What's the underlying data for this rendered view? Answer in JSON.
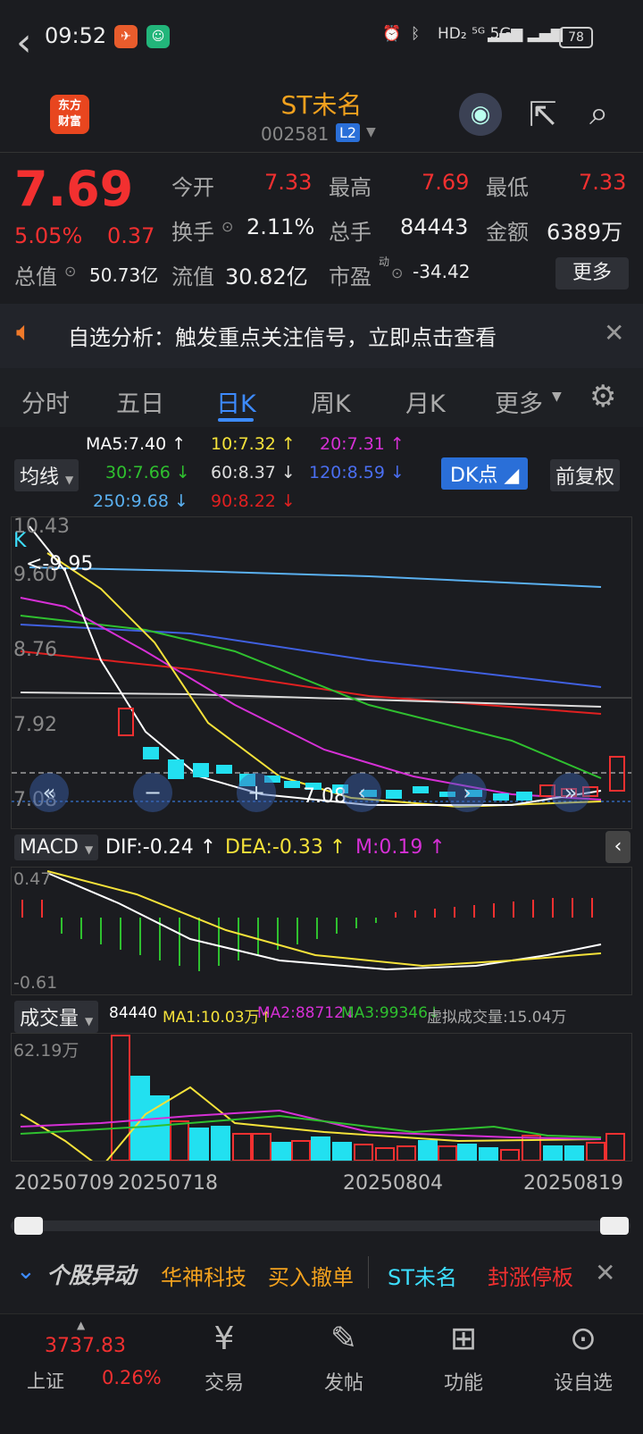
{
  "status_bar": {
    "time": "09:52",
    "battery": "78",
    "network": "HD₂ ⁵ᴳ 5G"
  },
  "header": {
    "back": "‹",
    "logo": "东方\n财富",
    "title": "ST未名",
    "code": "002581",
    "level": "L2"
  },
  "quote": {
    "price": "7.69",
    "change_pct": "5.05%",
    "change": "0.37",
    "open_label": "今开",
    "open": "7.33",
    "high_label": "最高",
    "high": "7.69",
    "low_label": "最低",
    "low": "7.33",
    "turnover_label": "换手",
    "turnover": "2.11%",
    "volume_label": "总手",
    "volume": "84443",
    "amount_label": "金额",
    "amount": "6389万",
    "mktcap_label": "总值",
    "mktcap": "50.73亿",
    "float_label": "流值",
    "float": "30.82亿",
    "pe_label": "市盈",
    "pe_sup": "动",
    "pe": "-34.42",
    "more": "更多"
  },
  "banner": {
    "text": "自选分析：触发重点关注信号，立即点击查看"
  },
  "tabs": [
    "分时",
    "五日",
    "日K",
    "周K",
    "月K",
    "更多"
  ],
  "ma": {
    "selector": "均线",
    "ma5": "MA5:7.40",
    "ma10": "10:7.32",
    "ma20": "20:7.31",
    "ma30": "30:7.66",
    "ma60": "60:8.37",
    "ma120": "120:8.59",
    "ma250": "250:9.68",
    "ma90": "90:8.22",
    "dk": "DK点",
    "adjust": "前复权"
  },
  "kline": {
    "y_labels": [
      "10.43",
      "9.60",
      "8.76",
      "7.92",
      "7.08"
    ],
    "marker_high": "9.95",
    "marker_low": "7.08",
    "k_label": "K",
    "colors": {
      "up": "#f23030",
      "down": "#22e0f0",
      "ma5": "#ffffff",
      "ma10": "#f5e23a",
      "ma20": "#d630d6",
      "ma30": "#2fc02f",
      "ma60": "#dddddd",
      "ma120": "#4060e0",
      "ma250": "#5ab0f0",
      "ma90": "#e02020"
    }
  },
  "macd": {
    "selector": "MACD",
    "dif": "DIF:-0.24",
    "dea": "DEA:-0.33",
    "m": "M:0.19",
    "top": "0.47",
    "bottom": "-0.61"
  },
  "volume": {
    "selector": "成交量",
    "value": "84440",
    "ma1": "MA1:10.03万",
    "ma2": "MA2:88712",
    "ma3": "MA3:99346",
    "virtual": "虚拟成交量:15.04万",
    "top": "62.19万"
  },
  "dates": [
    "20250709",
    "20250718",
    "20250804",
    "20250819"
  ],
  "ticker": {
    "title": "个股异动",
    "item1": "华神科技",
    "item1b": "买入撤单",
    "item2": "ST未名",
    "item2b": "封涨停板"
  },
  "bottom_nav": {
    "index_value": "3737.83",
    "index_name": "上证",
    "index_pct": "0.26%",
    "trade": "交易",
    "post": "发帖",
    "func": "功能",
    "watch": "设自选"
  }
}
